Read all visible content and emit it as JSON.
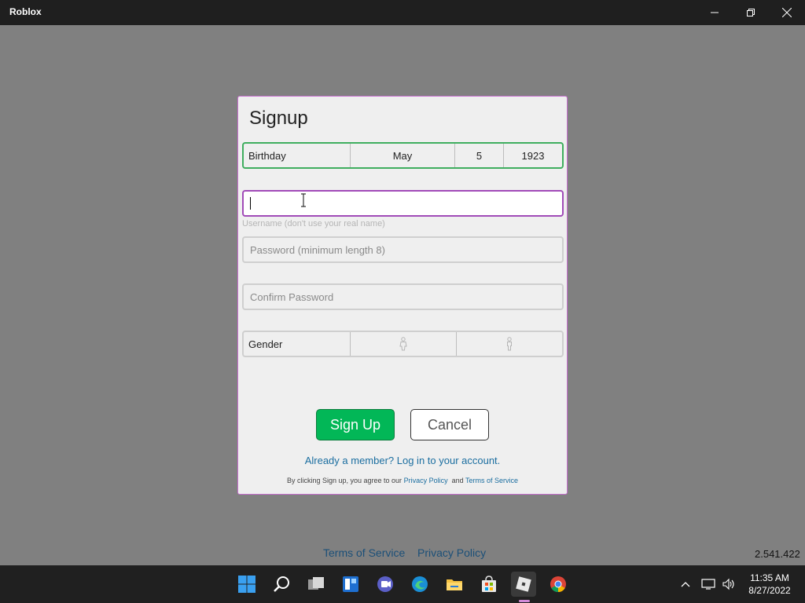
{
  "window": {
    "title": "Roblox"
  },
  "dialog": {
    "title": "Signup",
    "birthday": {
      "label": "Birthday",
      "month": "May",
      "day": "5",
      "year": "1923"
    },
    "username": {
      "value": "",
      "hint": "Username (don't use your real name)"
    },
    "password": {
      "placeholder": "Password (minimum length 8)"
    },
    "confirm": {
      "placeholder": "Confirm Password"
    },
    "gender": {
      "label": "Gender",
      "male_icon": "male-icon",
      "female_icon": "female-icon"
    },
    "signup_label": "Sign Up",
    "cancel_label": "Cancel",
    "member_link": "Already a member? Log in to your account.",
    "agree": {
      "prefix": "By clicking Sign up, you agree to our",
      "privacy": "Privacy Policy",
      "and": "and",
      "terms": "Terms of Service"
    },
    "colors": {
      "accent_green": "#02b757",
      "focus_purple": "#a14bb8",
      "link_blue": "#1b6ea0"
    }
  },
  "footer": {
    "terms": "Terms of Service",
    "privacy": "Privacy Policy",
    "version": "2.541.422"
  },
  "taskbar": {
    "icons": [
      "windows-start-icon",
      "search-icon",
      "task-view-icon",
      "widgets-icon",
      "teams-chat-icon",
      "edge-icon",
      "file-explorer-icon",
      "store-icon",
      "roblox-icon",
      "chrome-icon"
    ],
    "time": "11:35 AM",
    "date": "8/27/2022"
  }
}
